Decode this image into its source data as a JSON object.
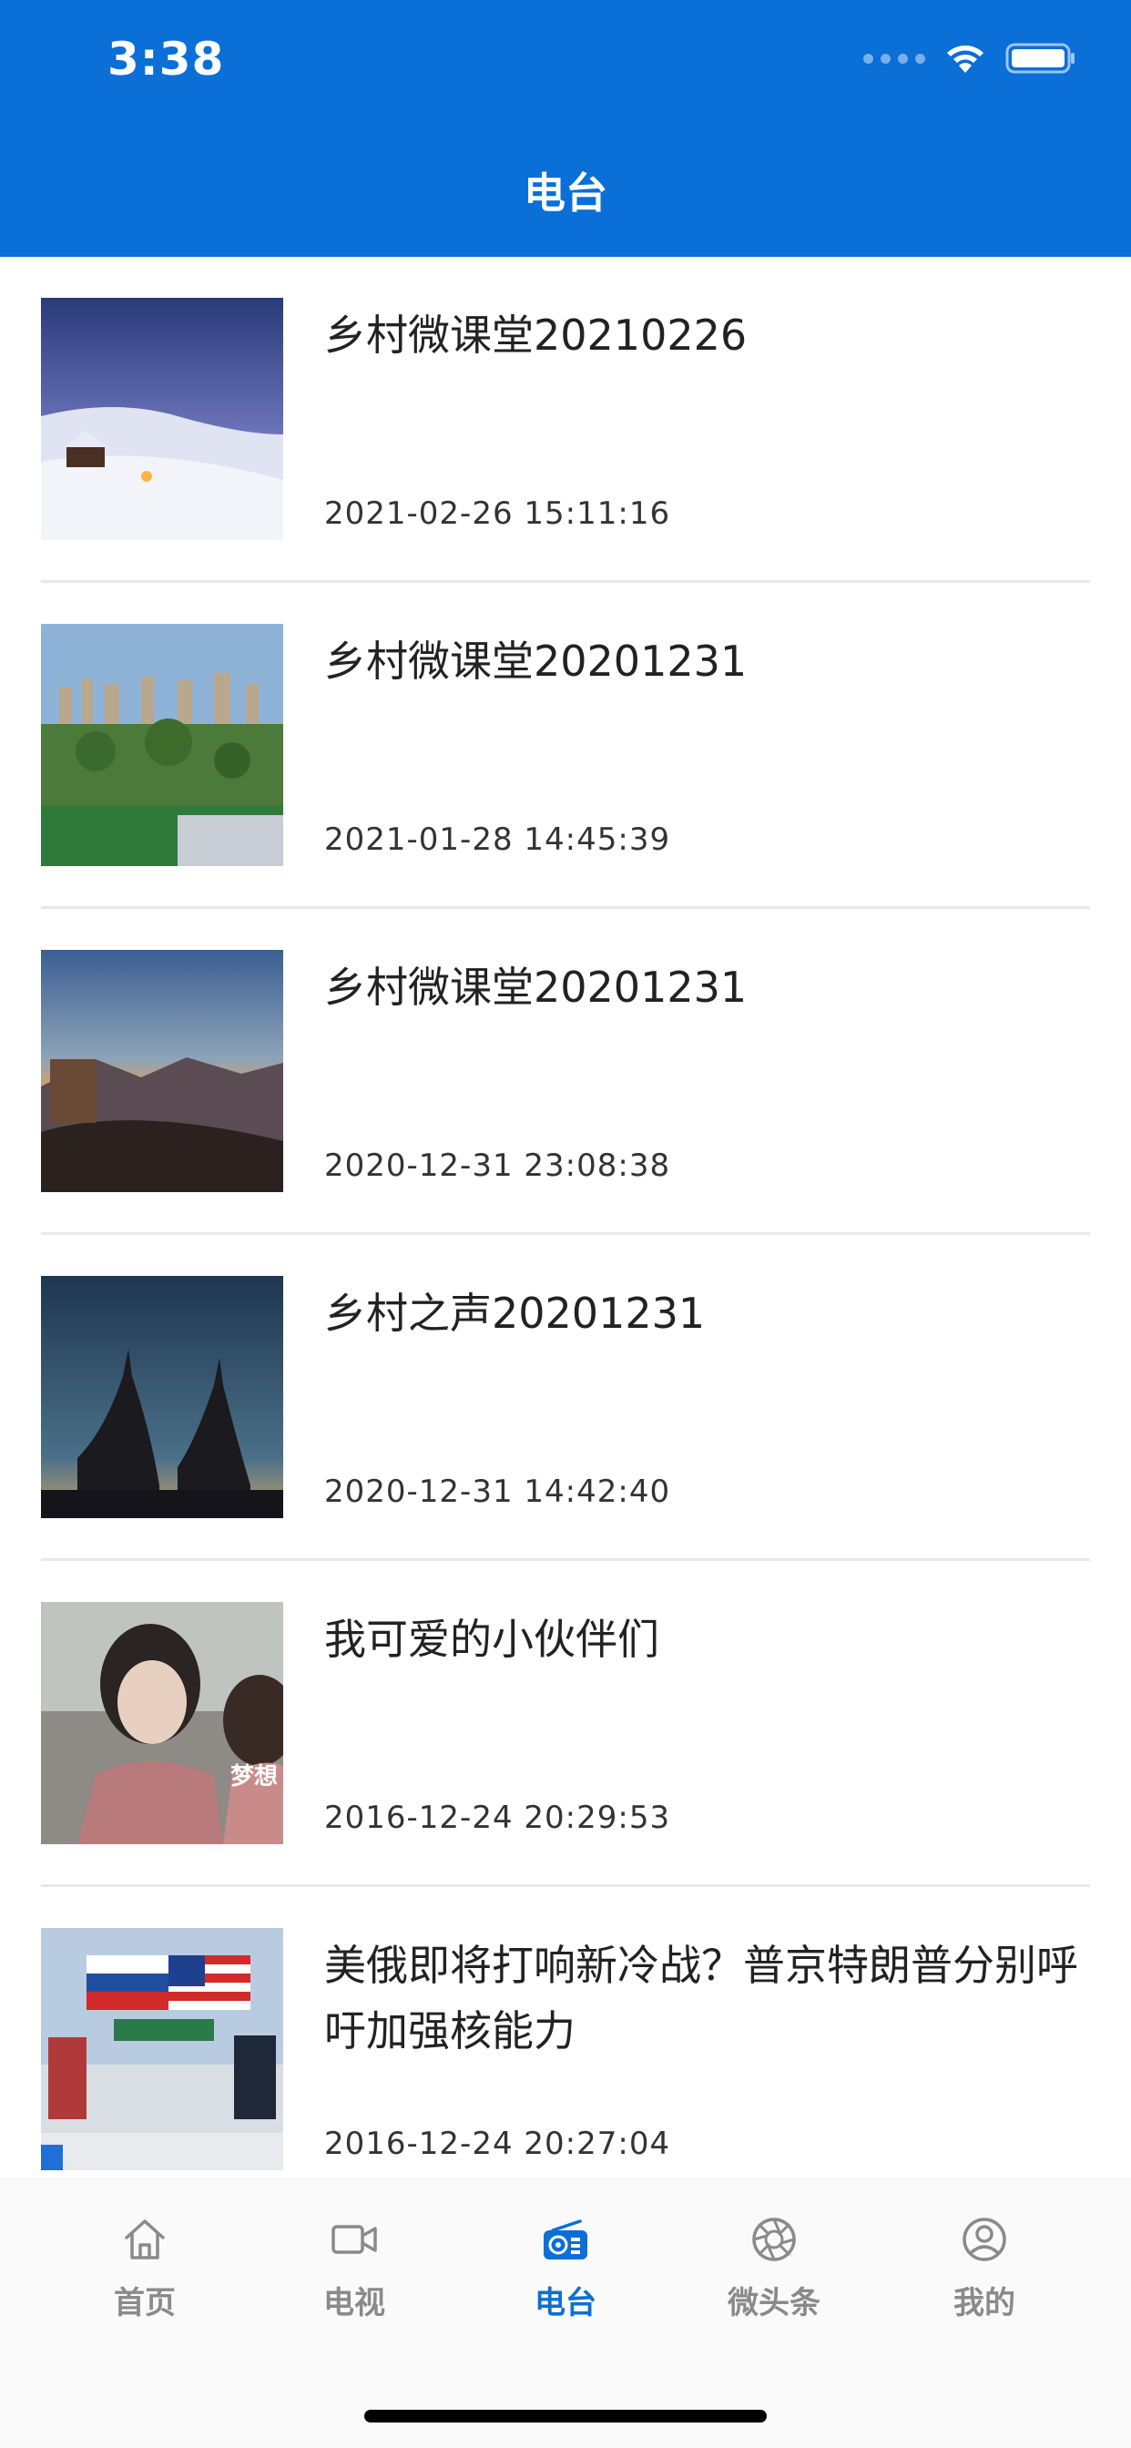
{
  "status_bar": {
    "time": "3:38"
  },
  "header": {
    "title": "电台"
  },
  "list": [
    {
      "title": "乡村微课堂20210226",
      "date": "2021-02-26 15:11:16",
      "thumb": "snowy-cabin-night"
    },
    {
      "title": "乡村微课堂20201231",
      "date": "2021-01-28 14:45:39",
      "thumb": "city-park-aerial"
    },
    {
      "title": "乡村微课堂20201231",
      "date": "2020-12-31 23:08:38",
      "thumb": "great-wall-sunset"
    },
    {
      "title": "乡村之声20201231",
      "date": "2020-12-31 14:42:40",
      "thumb": "silhouettes-pointing-sky"
    },
    {
      "title": "我可爱的小伙伴们",
      "date": "2016-12-24 20:29:53",
      "thumb": "students-classroom",
      "thumb_text": "梦想"
    },
    {
      "title": "美俄即将打响新冷战？普京特朗普分别呼吁加强核能力",
      "date": "2016-12-24 20:27:04",
      "thumb": "news-studio-flags"
    }
  ],
  "tabbar": {
    "items": [
      {
        "label": "首页",
        "icon": "home-icon",
        "active": false
      },
      {
        "label": "电视",
        "icon": "video-camera-icon",
        "active": false
      },
      {
        "label": "电台",
        "icon": "radio-icon",
        "active": true
      },
      {
        "label": "微头条",
        "icon": "aperture-icon",
        "active": false
      },
      {
        "label": "我的",
        "icon": "user-icon",
        "active": false
      }
    ]
  },
  "colors": {
    "primary": "#0a6fd6",
    "tab_inactive": "#8a8a8a",
    "divider": "#e9e9e9"
  }
}
